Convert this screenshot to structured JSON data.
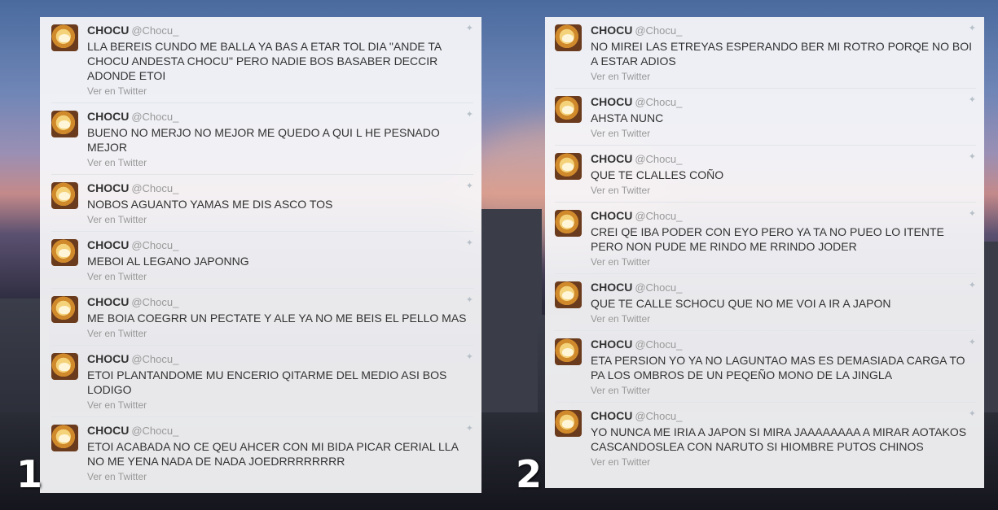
{
  "panels": [
    {
      "number": "1",
      "tweets": [
        {
          "name": "CHOCU",
          "handle": "@Chocu_",
          "text": "LLA BEREIS CUNDO ME BALLA YA BAS A ETAR TOL DIA \"ANDE TA CHOCU ANDESTA CHOCU\" PERO NADIE BOS BASABER DECCIR ADONDE ETOI",
          "link": "Ver en Twitter"
        },
        {
          "name": "CHOCU",
          "handle": "@Chocu_",
          "text": "BUENO NO MERJO NO MEJOR ME QUEDO A QUI L HE PESNADO MEJOR",
          "link": "Ver en Twitter"
        },
        {
          "name": "CHOCU",
          "handle": "@Chocu_",
          "text": "NOBOS AGUANTO YAMAS ME DIS ASCO TOS",
          "link": "Ver en Twitter"
        },
        {
          "name": "CHOCU",
          "handle": "@Chocu_",
          "text": "MEBOI AL LEGANO JAPONNG",
          "link": "Ver en Twitter"
        },
        {
          "name": "CHOCU",
          "handle": "@Chocu_",
          "text": "ME BOIA COEGRR UN PECTATE Y ALE YA NO ME BEIS EL PELLO MAS",
          "link": "Ver en Twitter"
        },
        {
          "name": "CHOCU",
          "handle": "@Chocu_",
          "text": "ETOI PLANTANDOME MU ENCERIO QITARME DEL MEDIO ASI BOS LODIGO",
          "link": "Ver en Twitter"
        },
        {
          "name": "CHOCU",
          "handle": "@Chocu_",
          "text": "ETOI ACABADA NO CE QEU AHCER CON MI BIDA PICAR CERIAL LLA NO ME YENA NADA DE NADA JOEDRRRRRRRR",
          "link": "Ver en Twitter"
        }
      ]
    },
    {
      "number": "2",
      "tweets": [
        {
          "name": "CHOCU",
          "handle": "@Chocu_",
          "text": "NO MIREI LAS ETREYAS ESPERANDO BER MI ROTRO PORQE NO BOI A ESTAR ADIOS",
          "link": "Ver en Twitter"
        },
        {
          "name": "CHOCU",
          "handle": "@Chocu_",
          "text": "AHSTA NUNC",
          "link": "Ver en Twitter"
        },
        {
          "name": "CHOCU",
          "handle": "@Chocu_",
          "text": "QUE TE CLALLES COÑO",
          "link": "Ver en Twitter"
        },
        {
          "name": "CHOCU",
          "handle": "@Chocu_",
          "text": "CREI QE IBA PODER CON EYO PERO YA TA NO PUEO LO ITENTE PERO NON PUDE ME RINDO ME RRINDO JODER",
          "link": "Ver en Twitter"
        },
        {
          "name": "CHOCU",
          "handle": "@Chocu_",
          "text": "QUE TE CALLE SCHOCU QUE NO ME VOI A IR A JAPON",
          "link": "Ver en Twitter"
        },
        {
          "name": "CHOCU",
          "handle": "@Chocu_",
          "text": "ETA PERSION YO YA NO LAGUNTAO MAS ES DEMASIADA CARGA TO PA LOS OMBROS DE UN PEQEÑO MONO DE LA JINGLA",
          "link": "Ver en Twitter"
        },
        {
          "name": "CHOCU",
          "handle": "@Chocu_",
          "text": "YO NUNCA ME IRIA A JAPON SI MIRA JAAAAAAAA A MIRAR AOTAKOS CASCANDOSLEA CON NARUTO SI HIOMBRE PUTOS CHINOS",
          "link": "Ver en Twitter"
        }
      ]
    }
  ]
}
